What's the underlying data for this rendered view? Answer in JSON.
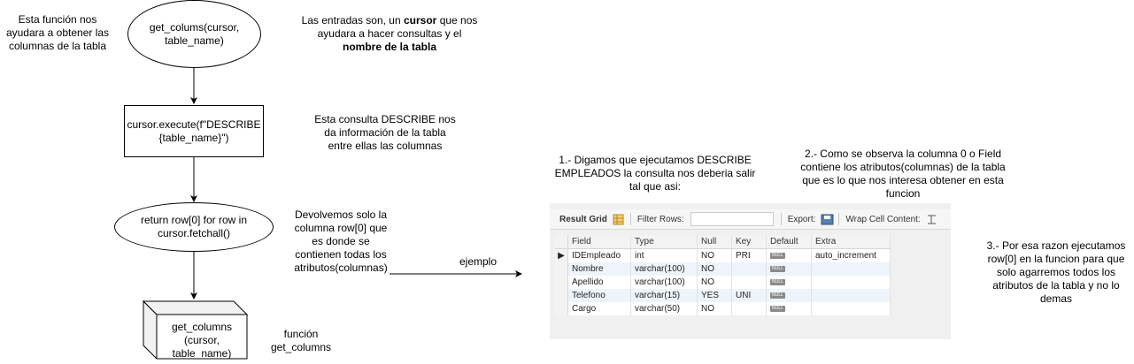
{
  "notes": {
    "left_top": [
      "Esta función nos",
      "ayudara a obtener las",
      "columnas de la tabla"
    ],
    "inputs_pre": "Las entradas son, un ",
    "inputs_bold1": "cursor",
    "inputs_mid": " que nos",
    "inputs_line2": "ayudara a hacer consultas y el",
    "inputs_bold2": "nombre de la tabla",
    "describe": [
      "Esta consulta DESCRIBE nos",
      "da información de la tabla",
      "entre ellas las columnas"
    ],
    "returns": [
      "Devolvemos solo la",
      "columna row[0] que",
      "es donde se",
      "contienen todas los",
      "atributos(columnas)"
    ],
    "funcion": [
      "función",
      "get_columns"
    ],
    "ejemplo": "ejemplo",
    "step1": [
      "1.- Digamos que ejecutamos DESCRIBE",
      "EMPLEADOS la consulta nos deberia salir",
      "tal que asi:"
    ],
    "step2": [
      "2.- Como se observa la columna 0 o Field",
      "contiene los atributos(columnas) de la tabla",
      "que es lo que nos interesa obtener en esta",
      "funcion"
    ],
    "step3": [
      "3.- Por esa razon ejecutamos",
      "row[0] en la funcion para que",
      "solo agarremos todos los",
      "atributos de la tabla y no lo",
      "demas"
    ]
  },
  "flow": {
    "start": [
      "get_colums(cursor,",
      "table_name)"
    ],
    "execute": [
      "cursor.execute(f\"DESCRIBE",
      "{table_name}\")"
    ],
    "return": [
      "return row[0] for row in",
      "cursor.fetchall()"
    ],
    "end": [
      "get_columns",
      "(cursor,",
      "table_name)"
    ]
  },
  "grid": {
    "toolbar": {
      "result_grid": "Result Grid",
      "filter_rows": "Filter Rows:",
      "export": "Export:",
      "wrap": "Wrap Cell Content:"
    },
    "columns": [
      "Field",
      "Type",
      "Null",
      "Key",
      "Default",
      "Extra"
    ],
    "null_label": "NULL",
    "rows": [
      {
        "field": "IDEmpleado",
        "type": "int",
        "null": "NO",
        "key": "PRI",
        "extra": "auto_increment"
      },
      {
        "field": "Nombre",
        "type": "varchar(100)",
        "null": "NO",
        "key": "",
        "extra": ""
      },
      {
        "field": "Apellido",
        "type": "varchar(100)",
        "null": "NO",
        "key": "",
        "extra": ""
      },
      {
        "field": "Telefono",
        "type": "varchar(15)",
        "null": "YES",
        "key": "UNI",
        "extra": ""
      },
      {
        "field": "Cargo",
        "type": "varchar(50)",
        "null": "NO",
        "key": "",
        "extra": ""
      }
    ]
  }
}
